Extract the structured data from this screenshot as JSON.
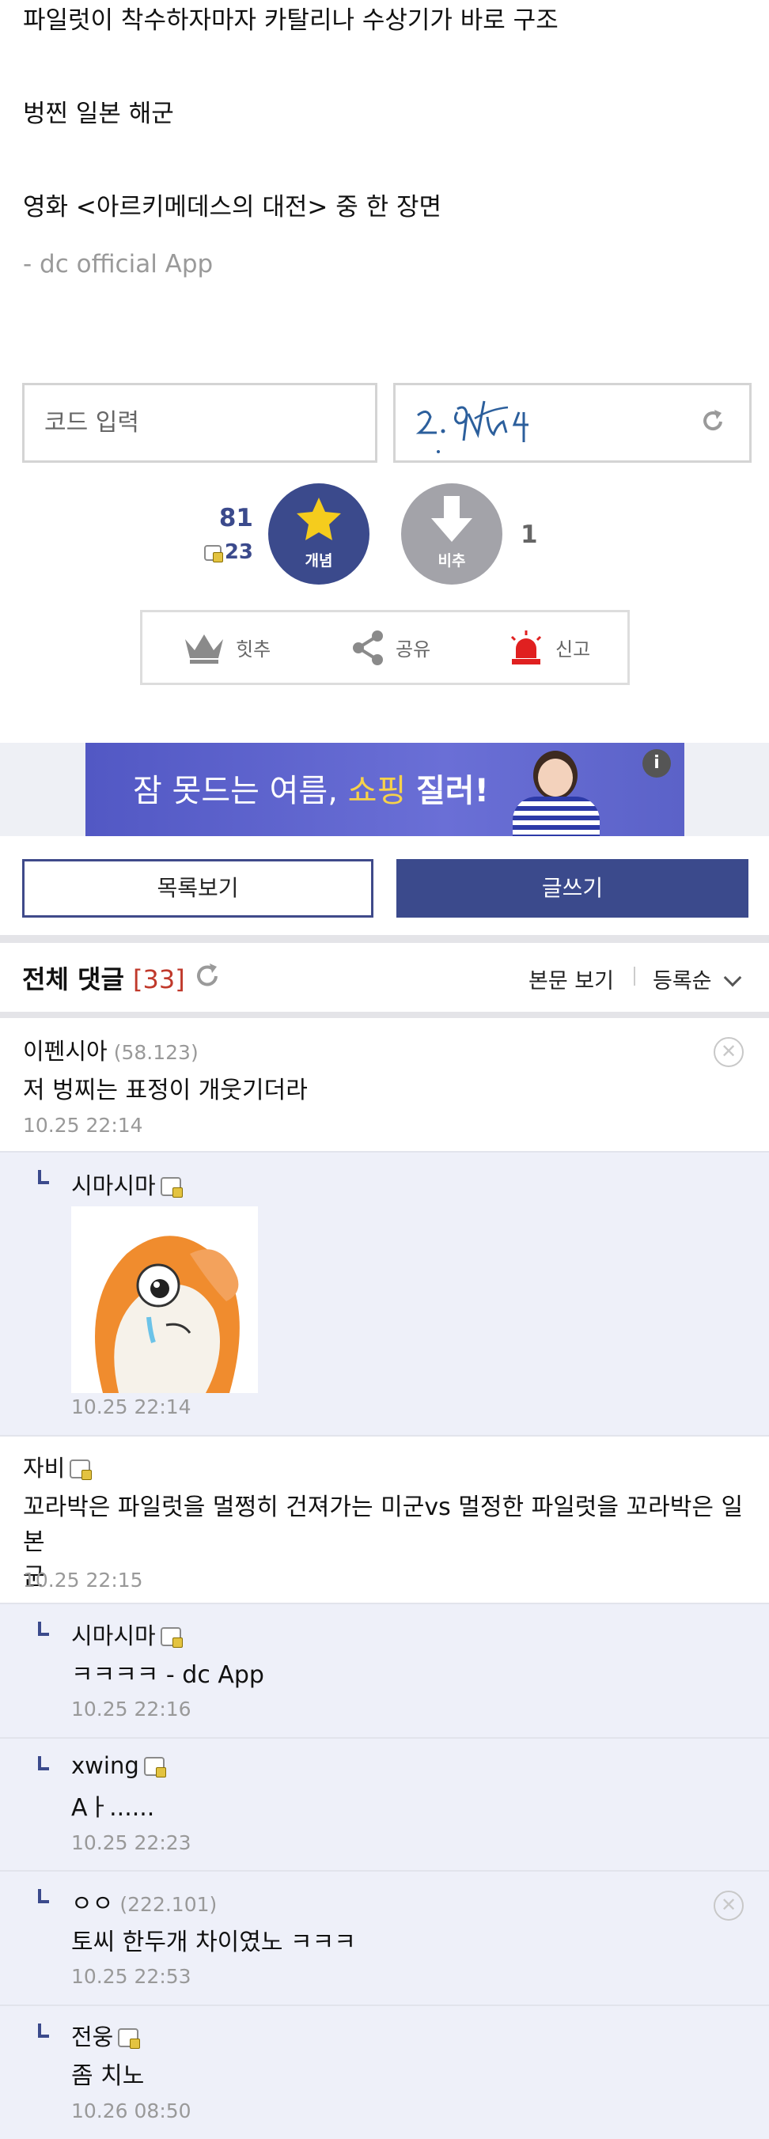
{
  "post": {
    "lines": [
      "파일럿이 착수하자마자 카탈리나 수상기가 바로 구조",
      "벙찐 일본 해군",
      "영화 <아르키메데스의 대전> 중 한 장면"
    ],
    "signature": "- dc official App"
  },
  "captcha": {
    "placeholder": "코드 입력",
    "code": "2.9VnY4",
    "refresh_icon": "refresh-icon"
  },
  "votes": {
    "up_count": "81",
    "fix_count": "23",
    "up_label": "개념",
    "down_label": "비추",
    "down_count": "1"
  },
  "actions": {
    "hit_label": "힛추",
    "share_label": "공유",
    "report_label": "신고"
  },
  "banner": {
    "text_a": "잠 못드는 여름,",
    "text_b": "쇼핑",
    "text_c": "질러!",
    "info": "i"
  },
  "buttons": {
    "list_label": "목록보기",
    "write_label": "글쓰기"
  },
  "comments_header": {
    "title": "전체 댓글",
    "count": "[33]",
    "view_body": "본문 보기",
    "sort": "등록순"
  },
  "comments": [
    {
      "name": "이펜시아",
      "ip": "(58.123)",
      "text": "저 벙찌는 표정이 개웃기더라",
      "date": "10.25 22:14"
    },
    {
      "name": "시마시마",
      "text": "",
      "date": "10.25 22:14"
    },
    {
      "name": "자비",
      "text_line1": "꼬라박은 파일럿을 멀쩡히 건져가는 미군vs 멀정한 파일럿을 꼬라박은 일본",
      "text_line2": "군",
      "date": "10.25 22:15"
    },
    {
      "name": "시마시마",
      "text": "ㅋㅋㅋㅋ - dc App",
      "date": "10.25 22:16"
    },
    {
      "name": "xwing",
      "text": "Aㅏ......",
      "date": "10.25 22:23"
    },
    {
      "name": "ㅇㅇ",
      "ip": "(222.101)",
      "text": "토씨 한두개 차이였노 ㅋㅋㅋ",
      "date": "10.25 22:53"
    },
    {
      "name": "전웅",
      "text": "좀 치노",
      "date": "10.26 08:50"
    }
  ],
  "colors": {
    "brand": "#3b4a8c",
    "reply_bg": "#eef0f9",
    "down_vote": "#a3a3a9",
    "count_red": "#c0392b"
  }
}
